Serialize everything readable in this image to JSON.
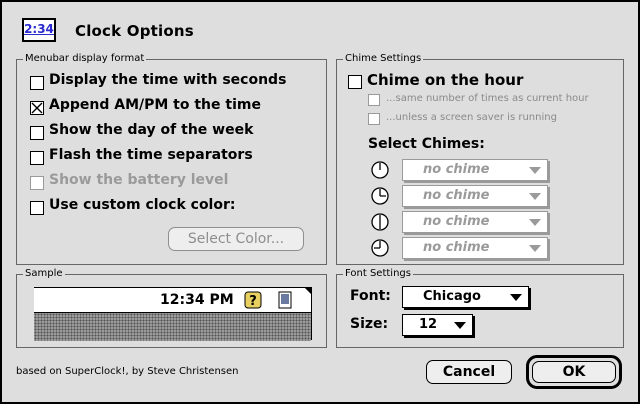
{
  "window": {
    "title": "Clock Options",
    "app_icon_text": "2:34"
  },
  "menubar_group": {
    "legend": "Menubar display format",
    "options": [
      {
        "label": "Display the time with seconds",
        "checked": false,
        "enabled": true
      },
      {
        "label": "Append AM/PM to the time",
        "checked": true,
        "enabled": true
      },
      {
        "label": "Show the day of the week",
        "checked": false,
        "enabled": true
      },
      {
        "label": "Flash the time separators",
        "checked": false,
        "enabled": true
      },
      {
        "label": "Show the battery level",
        "checked": false,
        "enabled": false
      },
      {
        "label": "Use custom clock color:",
        "checked": false,
        "enabled": true
      }
    ],
    "select_color_label": "Select Color..."
  },
  "chime_group": {
    "legend": "Chime Settings",
    "chime_on_hour": {
      "label": "Chime on the hour",
      "checked": false
    },
    "same_number": {
      "label": "...same number of times as current hour",
      "checked": false
    },
    "unless_saver": {
      "label": "...unless a screen saver is running",
      "checked": false
    },
    "select_chimes_label": "Select Chimes:",
    "chimes": [
      {
        "icon": "clock-hour-icon",
        "value": "no chime"
      },
      {
        "icon": "clock-quarter-icon",
        "value": "no chime"
      },
      {
        "icon": "clock-half-icon",
        "value": "no chime"
      },
      {
        "icon": "clock-three-quarter-icon",
        "value": "no chime"
      }
    ]
  },
  "sample_group": {
    "legend": "Sample",
    "time": "12:34 PM",
    "icons": [
      "help-icon",
      "battery-icon"
    ]
  },
  "font_group": {
    "legend": "Font Settings",
    "font_label": "Font:",
    "font_value": "Chicago",
    "size_label": "Size:",
    "size_value": "12"
  },
  "footer": {
    "credit": "based on SuperClock!, by Steve Christensen",
    "cancel_label": "Cancel",
    "ok_label": "OK"
  }
}
